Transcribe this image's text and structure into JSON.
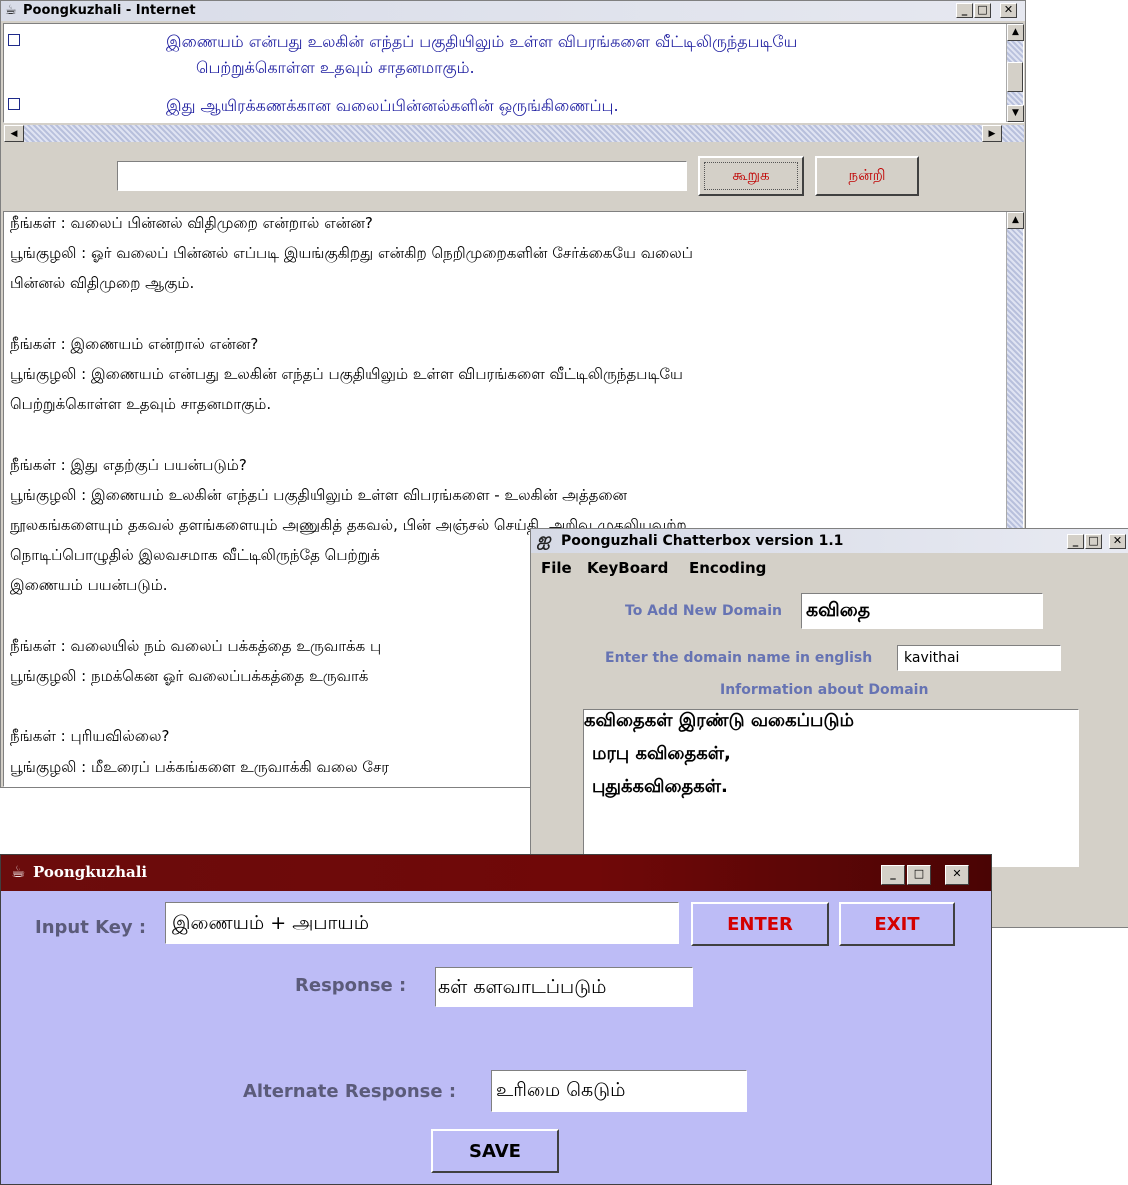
{
  "internet": {
    "title": "Poongkuzhali - Internet",
    "list_items": [
      {
        "line1": "இணையம் என்பது உலகின் எந்தப் பகுதியிலும் உள்ள விபரங்களை வீட்டிலிருந்தபடியே",
        "line2": "பெற்றுக்கொள்ள உதவும் சாதனமாகும்."
      },
      {
        "line1": "இது ஆயிரக்கணக்கான வலைப்பின்னல்களின் ஒருங்கிணைப்பு.",
        "line2": ""
      }
    ],
    "input_value": "",
    "say_button": "கூறுக",
    "thanks_button": "நன்றி",
    "chat_lines": [
      "நீங்கள் : வலைப் பின்னல் விதிமுறை என்றால் என்ன?",
      "பூங்குழலி : ஓர் வலைப் பின்னல் எப்படி இயங்குகிறது என்கிற நெறிமுறைகளின் சேர்க்கையே வலைப்",
      "பின்னல் விதிமுறை ஆகும்.",
      "",
      "நீங்கள் : இணையம் என்றால் என்ன?",
      "பூங்குழலி : இணையம் என்பது உலகின் எந்தப் பகுதியிலும் உள்ள விபரங்களை வீட்டிலிருந்தபடியே",
      "பெற்றுக்கொள்ள உதவும் சாதனமாகும்.",
      "",
      "நீங்கள் : இது எதற்குப் பயன்படும்?",
      "பூங்குழலி : இணையம் உலகின் எந்தப் பகுதியிலும் உள்ள விபரங்களை - உலகின் அத்தனை",
      "நூலகங்களையும் தகவல் தளங்களையும் அணுகித் தகவல், பின் அஞ்சல் செய்தி, அறிவு முதலியவற்ற",
      "நொடிப்பொழுதில் இலவசமாக வீட்டிலிருந்தே பெற்றுக்",
      "இணையம் பயன்படும்.",
      "",
      "நீங்கள் : வலையில் நம் வலைப் பக்கத்தை உருவாக்க பு",
      "பூங்குழலி : நமக்கென ஓர் வலைப்பக்கத்தை உருவாக்",
      "",
      "நீங்கள் : புரியவில்லை?",
      "பூங்குழலி : மீஉரைப் பக்கங்களை உருவாக்கி வலை சேர"
    ]
  },
  "chatterbox": {
    "title": "Poonguzhali Chatterbox version 1.1",
    "menu": [
      "File",
      "KeyBoard",
      "Encoding"
    ],
    "new_domain_label": "To Add New Domain",
    "new_domain_value": "கவிதை",
    "english_label": "Enter the domain name in english",
    "english_value": "kavithai",
    "info_label": "Information about Domain",
    "info_lines": [
      "கவிதைகள் இரண்டு வகைப்படும்",
      "மரபு கவிதைகள்,",
      "புதுக்கவிதைகள்."
    ]
  },
  "trainer": {
    "title": "Poongkuzhali",
    "input_key_label": "Input Key :",
    "input_key_value": "இணையம் + அபாயம்",
    "enter_button": "ENTER",
    "exit_button": "EXIT",
    "response_label": "Response :",
    "response_value": "கள் களவாடப்படும்",
    "alt_response_label": "Alternate Response :",
    "alt_response_value": "உரிமை கெடும்",
    "save_button": "SAVE"
  }
}
